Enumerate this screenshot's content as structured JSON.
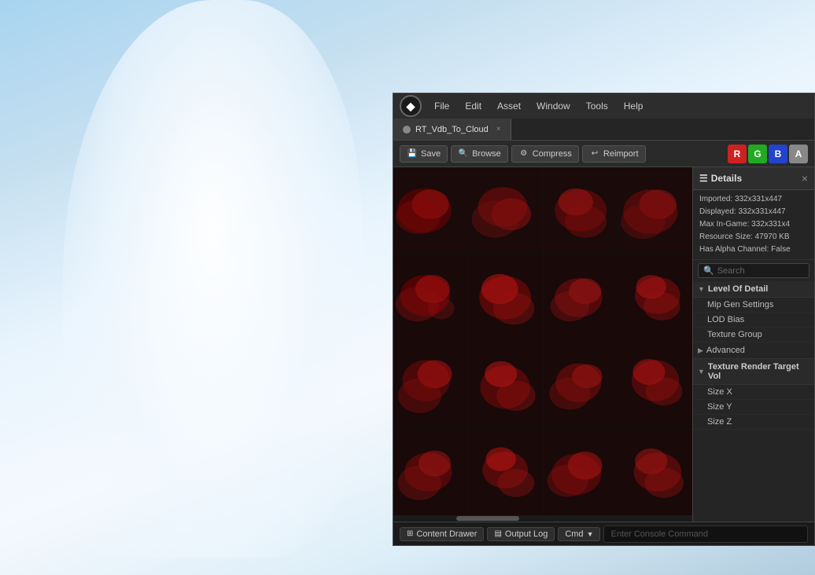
{
  "background": {
    "type": "sky-cloud"
  },
  "editor": {
    "title": "Unreal Engine",
    "menu": {
      "items": [
        "File",
        "Edit",
        "Asset",
        "Window",
        "Tools",
        "Help"
      ]
    },
    "tab": {
      "label": "RT_Vdb_To_Cloud",
      "close": "×"
    },
    "toolbar": {
      "save_label": "Save",
      "browse_label": "Browse",
      "compress_label": "Compress",
      "reimport_label": "Reimport",
      "channels": {
        "r": "R",
        "g": "G",
        "b": "B",
        "a": "A"
      }
    },
    "details": {
      "title": "Details",
      "close": "×",
      "info": {
        "imported": "Imported: 332x331x447",
        "displayed": "Displayed: 332x331x447",
        "max_in_game": "Max In-Game: 332x331x4",
        "resource_size": "Resource Size: 47970 KB",
        "has_alpha": "Has Alpha Channel: False"
      },
      "search_placeholder": "Search",
      "sections": [
        {
          "id": "level-of-detail",
          "label": "Level Of Detail",
          "expanded": true,
          "items": [
            "Mip Gen Settings",
            "LOD Bias",
            "Texture Group"
          ]
        }
      ],
      "advanced_label": "Advanced",
      "texture_render_section": {
        "label": "Texture Render Target Vol",
        "expanded": true,
        "items": [
          "Size X",
          "Size Y",
          "Size Z"
        ]
      }
    },
    "statusbar": {
      "content_drawer_label": "Content Drawer",
      "output_log_label": "Output Log",
      "cmd_label": "Cmd",
      "console_placeholder": "Enter Console Command"
    }
  }
}
